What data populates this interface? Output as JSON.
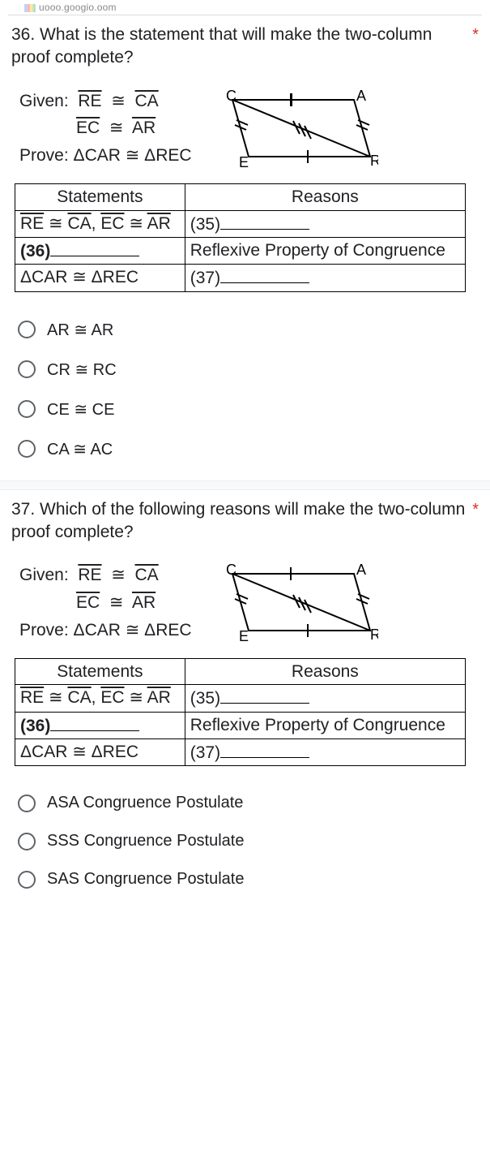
{
  "header_url_fragment": "uooo.googio.oom",
  "q36": {
    "prompt": "36. What is the statement that will make the two-column proof complete?",
    "required_mark": "*",
    "given_label": "Given:",
    "given_line1_a": "RE",
    "given_cong": "≅",
    "given_line1_b": "CA",
    "given_line2_a": "EC",
    "given_line2_b": "AR",
    "prove_label": "Prove:",
    "prove_text": "ΔCAR ≅ ΔREC",
    "diagram_labels": {
      "C": "C",
      "A": "A",
      "E": "E",
      "R": "R"
    },
    "table": {
      "h_statements": "Statements",
      "h_reasons": "Reasons",
      "r1_s_a": "RE",
      "r1_s_b": "CA",
      "r1_s_c": "EC",
      "r1_s_d": "AR",
      "r1_r": "(35)",
      "r2_s": "(36)",
      "r2_r": "Reflexive Property of Congruence",
      "r3_s": "ΔCAR ≅ ΔREC",
      "r3_r": "(37)"
    },
    "options": {
      "a": "AR ≅ AR",
      "b": "CR ≅ RC",
      "c": "CE ≅ CE",
      "d": "CA ≅ AC"
    }
  },
  "q37": {
    "prompt": "37. Which of the following reasons will make the two-column proof complete?",
    "required_mark": "*",
    "given_label": "Given:",
    "given_line1_a": "RE",
    "given_cong": "≅",
    "given_line1_b": "CA",
    "given_line2_a": "EC",
    "given_line2_b": "AR",
    "prove_label": "Prove:",
    "prove_text": "ΔCAR ≅ ΔREC",
    "diagram_labels": {
      "C": "C",
      "A": "A",
      "E": "E",
      "R": "R"
    },
    "table": {
      "h_statements": "Statements",
      "h_reasons": "Reasons",
      "r1_s_a": "RE",
      "r1_s_b": "CA",
      "r1_s_c": "EC",
      "r1_s_d": "AR",
      "r1_r": "(35)",
      "r2_s": "(36)",
      "r2_r": "Reflexive Property of Congruence",
      "r3_s": "ΔCAR ≅ ΔREC",
      "r3_r": "(37)"
    },
    "options": {
      "a": "ASA Congruence Postulate",
      "b": "SSS Congruence Postulate",
      "c": "SAS Congruence Postulate"
    }
  }
}
